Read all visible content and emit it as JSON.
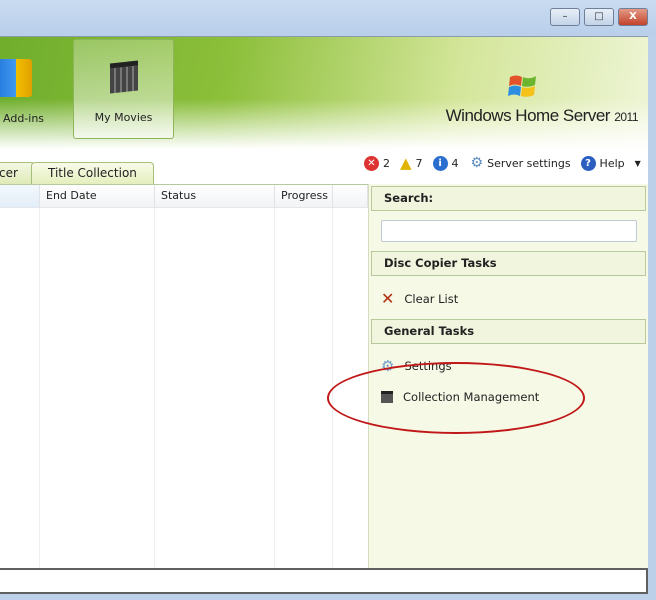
{
  "window": {
    "minimize": "–",
    "maximize": "□",
    "close": "X"
  },
  "nav": [
    {
      "label": "Add-ins",
      "icon": "addins-cube-icon"
    },
    {
      "label": "My Movies",
      "icon": "clapperboard-icon",
      "selected": true
    }
  ],
  "logo": {
    "brand": "Windows Home Server",
    "version": "2011"
  },
  "tabs": [
    {
      "label": "cer"
    },
    {
      "label": "Title Collection",
      "selected": true
    }
  ],
  "status": {
    "errors": "2",
    "warnings": "7",
    "info": "4",
    "server_settings": "Server settings",
    "help": "Help"
  },
  "table": {
    "columns": [
      "",
      "End Date",
      "Status",
      "Progress",
      ""
    ]
  },
  "panel": {
    "search_label": "Search:",
    "search_value": "",
    "disc_copier_title": "Disc Copier Tasks",
    "clear_list": "Clear List",
    "general_title": "General Tasks",
    "settings": "Settings",
    "collection_management": "Collection Management"
  },
  "colors": {
    "accent_green": "#8cbf3a",
    "panel_bg": "#f6f9e6",
    "highlight_oval": "#c01818"
  }
}
